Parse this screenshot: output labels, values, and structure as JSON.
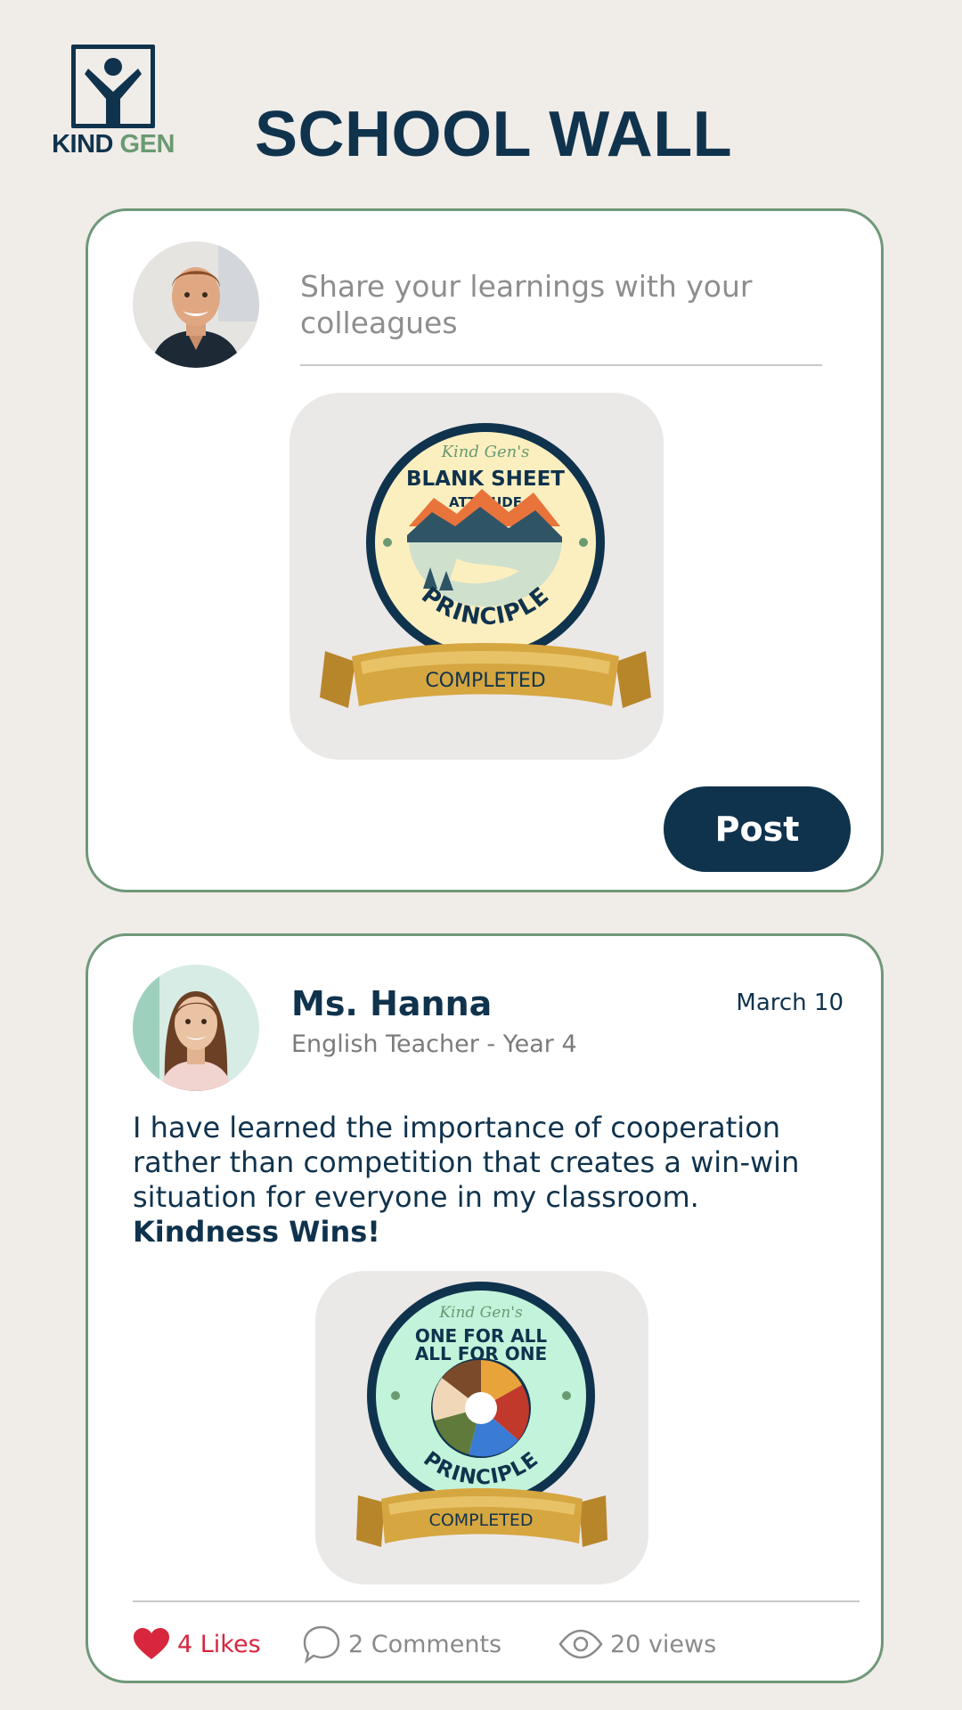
{
  "header": {
    "logo_kind": "KIND",
    "logo_gen": "GEN",
    "title": "SCHOOL WALL"
  },
  "composer": {
    "placeholder": "Share your learnings with your colleagues",
    "attached_badge": {
      "script": "Kind Gen's",
      "line1": "BLANK SHEET",
      "line2": "ATTITUDE",
      "principle": "PRINCIPLE",
      "ribbon": "COMPLETED"
    },
    "post_label": "Post"
  },
  "post": {
    "author": "Ms. Hanna",
    "role": "English Teacher - Year 4",
    "date": "March 10",
    "body": "I have learned the importance of cooperation rather than competition that creates a win-win situation for everyone in my classroom.",
    "emphasis": "Kindness Wins!",
    "badge": {
      "script": "Kind Gen's",
      "line1": "ONE FOR ALL",
      "line2": "ALL FOR ONE",
      "principle": "PRINCIPLE",
      "ribbon": "COMPLETED"
    },
    "likes": "4 Likes",
    "comments": "2 Comments",
    "views": "20 views"
  },
  "colors": {
    "navy": "#10334d",
    "sage": "#6f9878",
    "like_red": "#d7263d",
    "background": "#f0ece8"
  }
}
